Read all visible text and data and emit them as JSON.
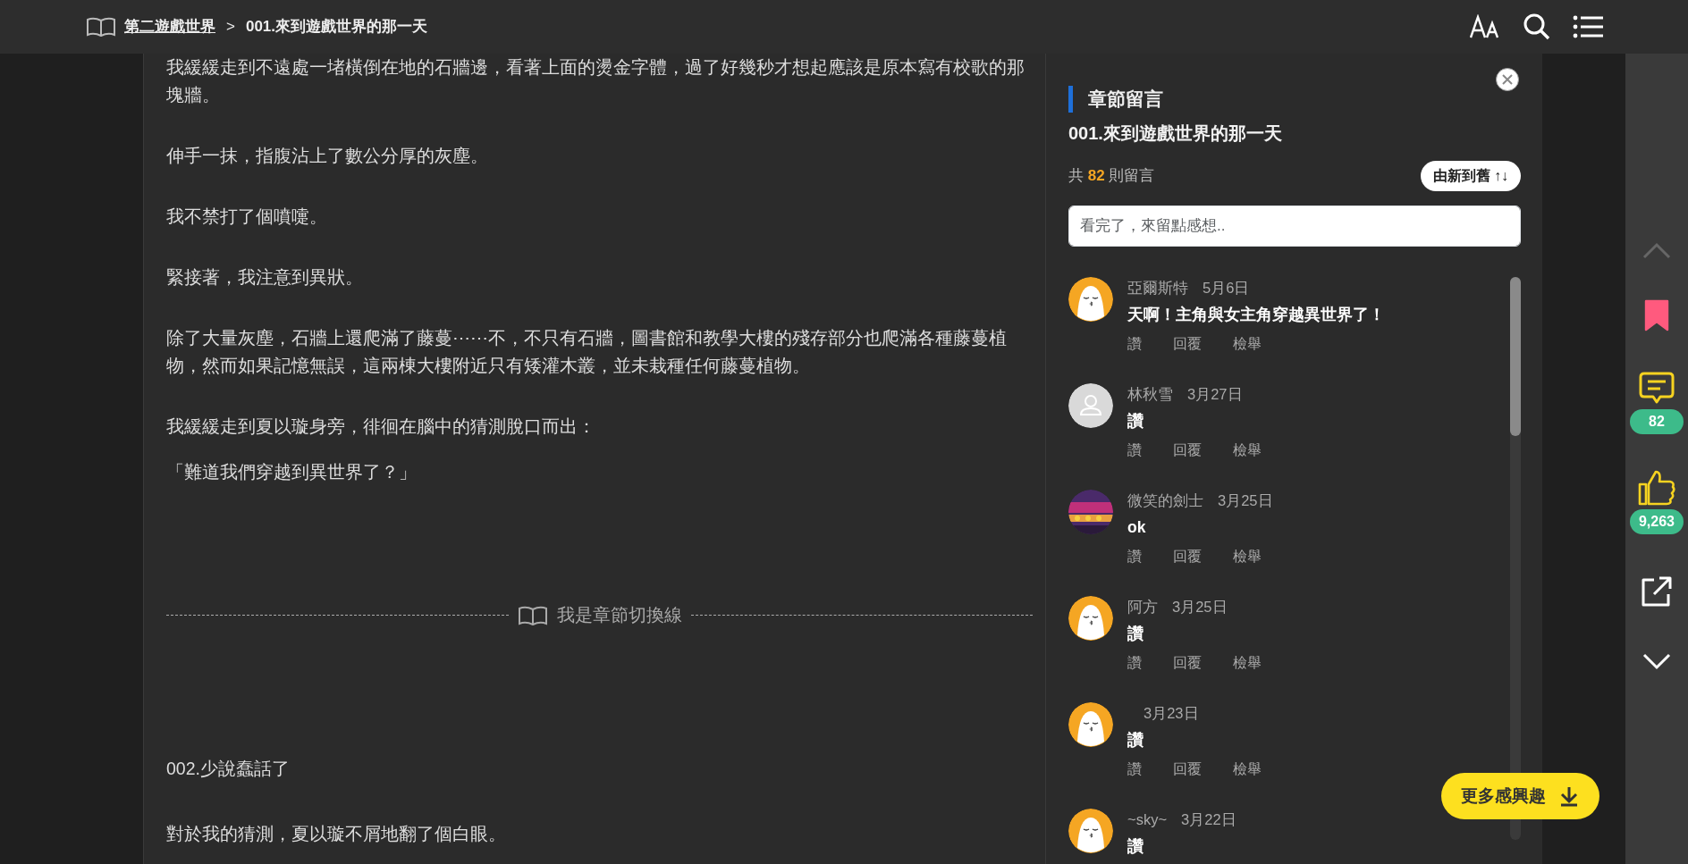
{
  "top_bar": {
    "book_title": "第二遊戲世界",
    "separator": ">",
    "chapter_title": "001.來到遊戲世界的那一天"
  },
  "article": {
    "blocks": [
      {
        "kind": "text",
        "text": "我緩緩走到不遠處一堵橫倒在地的石牆邊，看著上面的燙金字體，過了好幾秒才想起應該是原本寫有校歌的那塊牆。"
      },
      {
        "kind": "text",
        "text": "伸手一抹，指腹沾上了數公分厚的灰塵。"
      },
      {
        "kind": "text",
        "text": "我不禁打了個噴嚏。"
      },
      {
        "kind": "text",
        "text": "緊接著，我注意到異狀。"
      },
      {
        "kind": "text",
        "text": "除了大量灰塵，石牆上還爬滿了藤蔓⋯⋯不，不只有石牆，圖書館和教學大樓的殘存部分也爬滿各種藤蔓植物，然而如果記憶無誤，這兩棟大樓附近只有矮灌木叢，並未栽種任何藤蔓植物。"
      },
      {
        "kind": "text",
        "text": "我緩緩走到夏以璇身旁，徘徊在腦中的猜測脫口而出："
      },
      {
        "kind": "text",
        "text": "「難道我們穿越到異世界了？」"
      },
      {
        "kind": "divider",
        "text": "我是章節切換線"
      },
      {
        "kind": "heading",
        "text": "002.少說蠢話了"
      },
      {
        "kind": "text",
        "text": "對於我的猜測，夏以璇不屑地翻了個白眼。"
      }
    ]
  },
  "comments_panel": {
    "title": "章節留言",
    "chapter_title": "001.來到遊戲世界的那一天",
    "count_prefix": "共",
    "count": "82",
    "count_suffix": "則留言",
    "sort_button": "由新到舊 ↑↓",
    "placeholder": "看完了，來留點感想..",
    "comments": [
      {
        "kind": "default",
        "name": "亞爾斯特",
        "date": "5月6日",
        "text": "天啊！主角與女主角穿越異世界了！",
        "actions": [
          "讚",
          "回覆",
          "檢舉"
        ]
      },
      {
        "kind": "blank",
        "name": "林秋雪",
        "date": "3月27日",
        "text": "讚",
        "actions": [
          "讚",
          "回覆",
          "檢舉"
        ]
      },
      {
        "kind": "picture",
        "name": "微笑的劍士",
        "date": "3月25日",
        "text": "ok",
        "actions": [
          "讚",
          "回覆",
          "檢舉"
        ]
      },
      {
        "kind": "default",
        "name": "阿方",
        "date": "3月25日",
        "text": "讚",
        "actions": [
          "讚",
          "回覆",
          "檢舉"
        ]
      },
      {
        "kind": "default",
        "date": "3月23日",
        "text": "讚",
        "actions": [
          "讚",
          "回覆",
          "檢舉"
        ]
      },
      {
        "kind": "default",
        "name": "~sky~",
        "date": "3月22日",
        "text": "讚"
      }
    ],
    "more_button": "更多感興趣"
  },
  "rail": {
    "scroll_up_disabled": true,
    "bookmarked": true,
    "comment_count": "82",
    "like_count": "9,263"
  }
}
